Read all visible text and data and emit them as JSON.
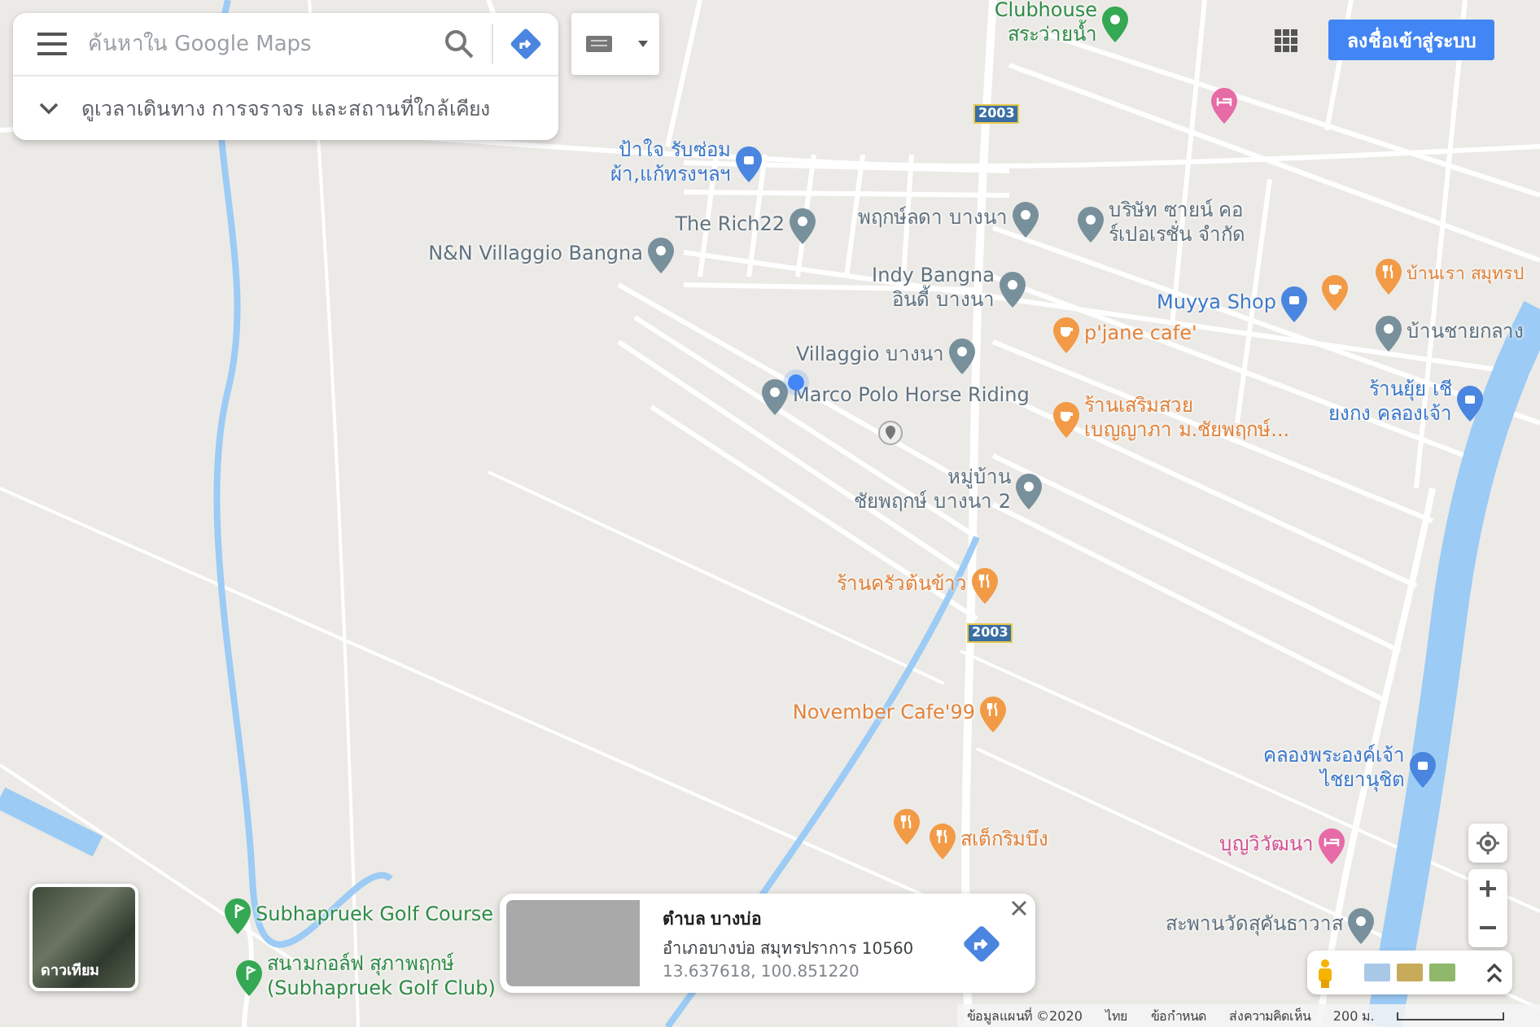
{
  "search": {
    "placeholder": "ค้นหาใน Google Maps"
  },
  "explore": {
    "label": "ดูเวลาเดินทาง การจราจร และสถานที่ใกล้เคียง",
    "expanded": false
  },
  "sign_in": "ลงชื่อเข้าสู่ระบบ",
  "places": [
    {
      "kind": "park",
      "lines": [
        "Clubhouse",
        "สระว่ายน้ำ"
      ]
    },
    {
      "kind": "shop",
      "lines": [
        "ป้าใจ รับซ่อม",
        "ผ้า,แก้ทรงฯลฯ"
      ]
    },
    {
      "kind": "place",
      "lines": [
        "The Rich22"
      ]
    },
    {
      "kind": "place",
      "lines": [
        "N&N Villaggio Bangna"
      ]
    },
    {
      "kind": "place",
      "lines": [
        "พฤกษ์ลดา บางนา"
      ]
    },
    {
      "kind": "place",
      "lines": [
        "บริษัท ซายน์ คอ",
        "ร์เปอเรชั่น จำกัด"
      ]
    },
    {
      "kind": "place",
      "lines": [
        "Indy Bangna",
        "อินดี้ บางนา"
      ]
    },
    {
      "kind": "cafe",
      "lines": [
        "p'jane cafe'"
      ]
    },
    {
      "kind": "shop",
      "lines": [
        "Muyya Shop"
      ]
    },
    {
      "kind": "cafe"
    },
    {
      "kind": "restaurant",
      "lines": [
        "บ้านเรา สมุทรป"
      ]
    },
    {
      "kind": "place",
      "lines": [
        "บ้านชายกลาง"
      ]
    },
    {
      "kind": "place",
      "lines": [
        "Villaggio บางนา"
      ]
    },
    {
      "kind": "place",
      "lines": [
        "Marco Polo Horse Riding"
      ]
    },
    {
      "kind": "cafe",
      "lines": [
        "ร้านเสริมสวย",
        "เบญญาภา ม.ชัยพฤกษ์..."
      ]
    },
    {
      "kind": "shop",
      "lines": [
        "ร้านยุ้ย เชี",
        "ยงกง คลองเจ้า"
      ]
    },
    {
      "kind": "landmark"
    },
    {
      "kind": "place",
      "lines": [
        "หมู่บ้าน",
        "ชัยพฤกษ์ บางนา 2"
      ]
    },
    {
      "kind": "restaurant",
      "lines": [
        "ร้านครัวต้นข้าว"
      ]
    },
    {
      "kind": "restaurant",
      "lines": [
        "November Cafe'99"
      ]
    },
    {
      "kind": "shop",
      "lines": [
        "คลองพระองค์เจ้า",
        "ไชยานุชิต"
      ]
    },
    {
      "kind": "hotel",
      "lines": [
        "บุญวิวัฒนา"
      ]
    },
    {
      "kind": "restaurant"
    },
    {
      "kind": "restaurant",
      "lines": [
        "สเต็กริมบึง"
      ]
    },
    {
      "kind": "golf",
      "lines": [
        "Subhapruek Golf Course"
      ]
    },
    {
      "kind": "golf",
      "lines": [
        "สนามกอล์ฟ สุภาพฤกษ์",
        "(Subhapruek Golf Club)"
      ]
    },
    {
      "kind": "place",
      "lines": [
        "สะพานวัดสุคันธาวาส"
      ]
    },
    {
      "kind": "hotel"
    }
  ],
  "road_shields": [
    "2003",
    "2003"
  ],
  "info_card": {
    "title": "ตำบล บางบ่อ",
    "address": "อำเภอบางบ่อ สมุทรปราการ 10560",
    "coords": "13.637618, 100.851220"
  },
  "layer_button": {
    "label": "ดาวเทียม"
  },
  "footer": {
    "map_data": "ข้อมูลแผนที่ ©2020",
    "links": [
      "ไทย",
      "ข้อกำหนด",
      "ส่งความคิดเห็น"
    ],
    "scale": "200 ม."
  }
}
